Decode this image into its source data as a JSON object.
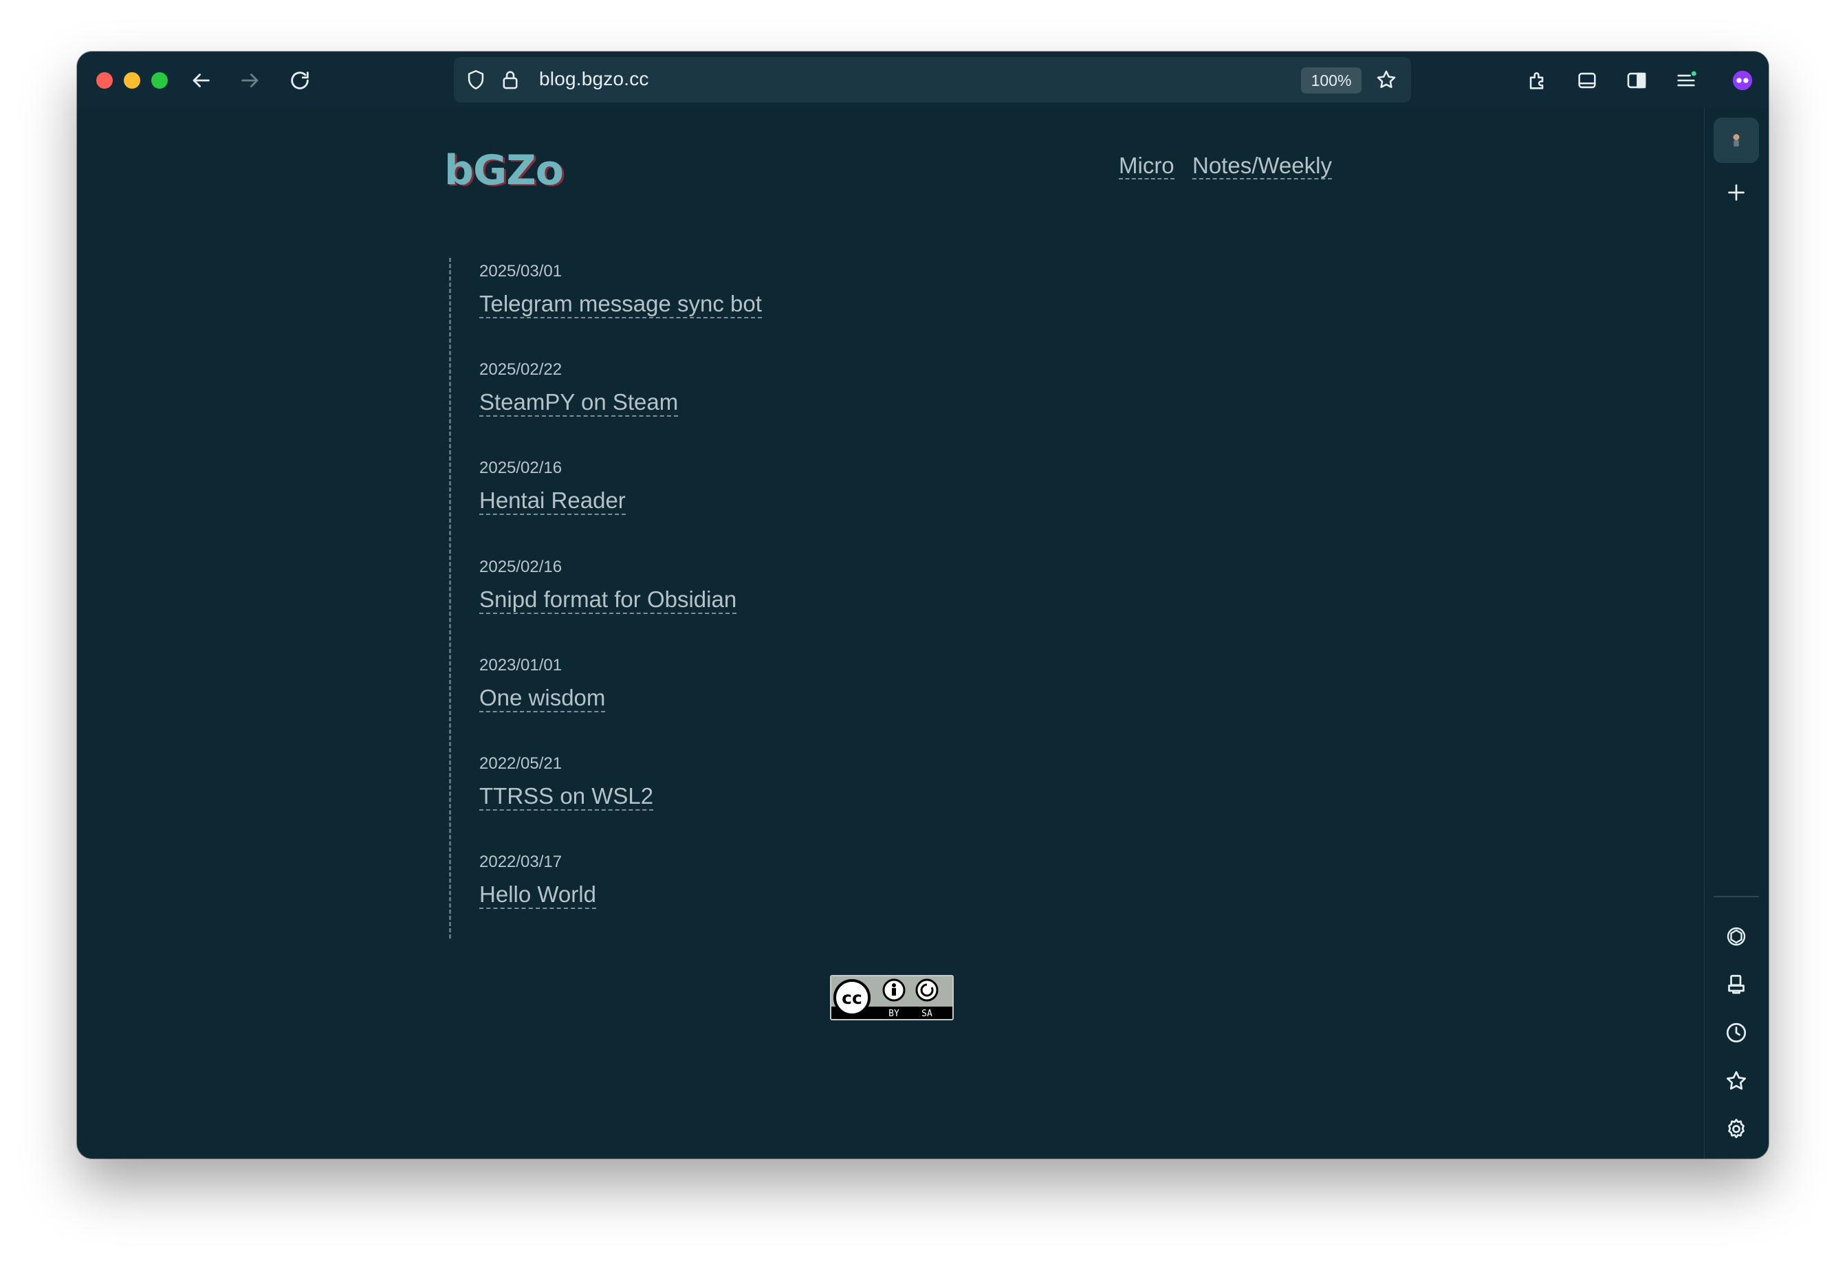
{
  "browser": {
    "url": "blog.bgzo.cc",
    "zoom": "100%",
    "traffic_lights": {
      "close": "#ff5f57",
      "minimize": "#febc2e",
      "maximize": "#28c840"
    }
  },
  "site": {
    "logo": "bGZo",
    "nav": [
      {
        "label": "Micro"
      },
      {
        "label": "Notes/Weekly"
      }
    ],
    "posts": [
      {
        "date": "2025/03/01",
        "title": "Telegram message sync bot"
      },
      {
        "date": "2025/02/22",
        "title": "SteamPY on Steam"
      },
      {
        "date": "2025/02/16",
        "title": "Hentai Reader"
      },
      {
        "date": "2025/02/16",
        "title": "Snipd format for Obsidian"
      },
      {
        "date": "2023/01/01",
        "title": "One wisdom"
      },
      {
        "date": "2022/05/21",
        "title": "TTRSS on WSL2"
      },
      {
        "date": "2022/03/17",
        "title": "Hello World"
      }
    ],
    "license_badge": {
      "by": "BY",
      "sa": "SA"
    }
  },
  "colors": {
    "background": "#0d2733",
    "link": "#b5c3c8",
    "logo": "#6fb5bd",
    "logo_shadow": "#8a2d3a"
  }
}
